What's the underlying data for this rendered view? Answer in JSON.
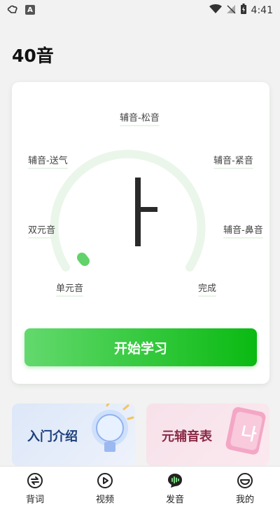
{
  "status_bar": {
    "time": "4:41",
    "app_icon": "cloud-app-icon",
    "a_badge": "A"
  },
  "page": {
    "title": "40音"
  },
  "map": {
    "center_char": "ㅏ",
    "nodes": {
      "top": "辅音-松音",
      "left_upper": "辅音-送气",
      "right_upper": "辅音-紧音",
      "left_mid": "双元音",
      "right_mid": "辅音-鼻音",
      "bottom_left": "单元音",
      "bottom_right": "完成"
    },
    "colors": {
      "track": "#eaf6ea",
      "progress": "#62d26a"
    }
  },
  "actions": {
    "start_label": "开始学习"
  },
  "promos": [
    {
      "label": "入门介绍"
    },
    {
      "label": "元辅音表"
    }
  ],
  "bottom_nav": [
    {
      "label": "背词",
      "icon": "swap-icon"
    },
    {
      "label": "视频",
      "icon": "play-icon"
    },
    {
      "label": "发音",
      "icon": "voice-icon"
    },
    {
      "label": "我的",
      "icon": "face-icon"
    }
  ]
}
